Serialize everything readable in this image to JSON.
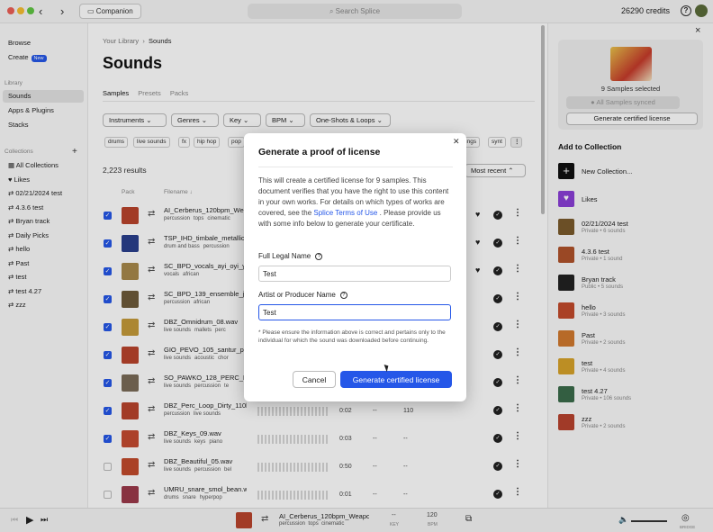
{
  "topbar": {
    "app_label": "Companion",
    "search_placeholder": "Search Splice",
    "credits": "26290 credits"
  },
  "sidebar": {
    "top": [
      {
        "label": "Browse"
      },
      {
        "label": "Create",
        "badge": "New"
      }
    ],
    "library_head": "Library",
    "library": [
      {
        "label": "Sounds",
        "active": true
      },
      {
        "label": "Apps & Plugins"
      },
      {
        "label": "Stacks"
      }
    ],
    "collections_head": "Collections",
    "collections_add": "+",
    "collections": [
      {
        "label": "All Collections"
      },
      {
        "label": "Likes"
      },
      {
        "label": "02/21/2024 test"
      },
      {
        "label": "4.3.6 test"
      },
      {
        "label": "Bryan track"
      },
      {
        "label": "Daily Picks"
      },
      {
        "label": "hello"
      },
      {
        "label": "Past"
      },
      {
        "label": "test"
      },
      {
        "label": "test 4.27"
      },
      {
        "label": "zzz"
      }
    ]
  },
  "main": {
    "breadcrumb_root": "Your Library",
    "breadcrumb_current": "Sounds",
    "title": "Sounds",
    "tabs": [
      {
        "label": "Samples",
        "active": true
      },
      {
        "label": "Presets"
      },
      {
        "label": "Packs"
      }
    ],
    "filters": [
      {
        "label": "Instruments"
      },
      {
        "label": "Genres"
      },
      {
        "label": "Key"
      },
      {
        "label": "BPM"
      },
      {
        "label": "One-Shots & Loops"
      }
    ],
    "tags": [
      "drums",
      "live sounds",
      "fx",
      "hip hop",
      "pop",
      "rings",
      "synt"
    ],
    "results": "2,223 results",
    "sort": "Most recent",
    "col_pack": "Pack",
    "col_filename": "Filename",
    "rows": [
      {
        "name": "AI_Cerberus_120bpm_Wea",
        "tags": [
          "percussion",
          "tops",
          "cinematic"
        ],
        "checked": true
      },
      {
        "name": "TSP_IHD_timbale_metallic",
        "tags": [
          "drum and bass",
          "percussion"
        ],
        "checked": true
      },
      {
        "name": "SC_BPD_vocals_ayi_oyi_ye",
        "tags": [
          "vocals",
          "african"
        ],
        "checked": true
      },
      {
        "name": "SC_BPD_139_ensemble_jar",
        "tags": [
          "percussion",
          "african"
        ],
        "checked": true
      },
      {
        "name": "DBZ_Omnidrum_08.wav",
        "tags": [
          "live sounds",
          "mallets",
          "perc"
        ],
        "checked": true
      },
      {
        "name": "GIO_PEVO_105_santur_pad",
        "tags": [
          "live sounds",
          "acoustic",
          "chor"
        ],
        "checked": true
      },
      {
        "name": "SO_PAWKO_128_PERC_LOO",
        "tags": [
          "live sounds",
          "percussion",
          "te"
        ],
        "checked": true
      },
      {
        "name": "DBZ_Perc_Loop_Dirty_110b",
        "tags": [
          "percussion",
          "live sounds"
        ],
        "checked": true,
        "time": "0:02",
        "key": "--",
        "bpm": "110"
      },
      {
        "name": "DBZ_Keys_09.wav",
        "tags": [
          "live sounds",
          "keys",
          "piano"
        ],
        "checked": true,
        "time": "0:03",
        "key": "--",
        "bpm": "--"
      },
      {
        "name": "DBZ_Beautiful_05.wav",
        "tags": [
          "live sounds",
          "percussion",
          "bel"
        ],
        "checked": false,
        "time": "0:50",
        "key": "--",
        "bpm": "--"
      },
      {
        "name": "UMRU_snare_smol_bean.w",
        "tags": [
          "drums",
          "snare",
          "hyperpop"
        ],
        "checked": false,
        "time": "0:01",
        "key": "--",
        "bpm": "--"
      }
    ]
  },
  "right_panel": {
    "selected": "9 Samples selected",
    "synced": "All Samples synced",
    "generate": "Generate certified license",
    "add_heading": "Add to Collection",
    "collections": [
      {
        "name": "New Collection...",
        "meta": "",
        "color": "#111111"
      },
      {
        "name": "Likes",
        "meta": "",
        "color": "#8a3fd6"
      },
      {
        "name": "02/21/2024 test",
        "meta": "Private • 6 sounds",
        "color": "#7a5a2c"
      },
      {
        "name": "4.3.6 test",
        "meta": "Private • 1 sound",
        "color": "#b0532b"
      },
      {
        "name": "Bryan track",
        "meta": "Public • 5 sounds",
        "color": "#222222"
      },
      {
        "name": "hello",
        "meta": "Private • 3 sounds",
        "color": "#c24a2c"
      },
      {
        "name": "Past",
        "meta": "Private • 2 sounds",
        "color": "#d1792e"
      },
      {
        "name": "test",
        "meta": "Private • 4 sounds",
        "color": "#d6a22a"
      },
      {
        "name": "test 4.27",
        "meta": "Private • 106 sounds",
        "color": "#3b6b4a"
      },
      {
        "name": "zzz",
        "meta": "Private • 2 sounds",
        "color": "#b8432e"
      }
    ]
  },
  "player": {
    "title": "AI_Cerberus_120bpm_Weapo",
    "tags": [
      "percussion",
      "tops",
      "cinematic"
    ],
    "key_value": "--",
    "key_label": "KEY",
    "bpm_value": "120",
    "bpm_label": "BPM",
    "bridge": "BRIDGE"
  },
  "modal": {
    "title": "Generate a proof of license",
    "body_pre": "This will create a certified license for 9 samples. This document verifies that you have the right to use this content in your own works. For details on which types of works are covered, see the",
    "body_link": "Splice Terms of Use",
    "body_post": ". Please provide us with some info below to generate your certificate.",
    "legal_label": "Full Legal Name",
    "legal_value": "Test",
    "artist_label": "Artist or Producer Name",
    "artist_value": "Test",
    "note": "* Please ensure the information above is correct and pertains only to the individual for which the sound was downloaded before continuing.",
    "cancel": "Cancel",
    "generate": "Generate certified license"
  },
  "colors": {
    "accent": "#2557e8"
  }
}
